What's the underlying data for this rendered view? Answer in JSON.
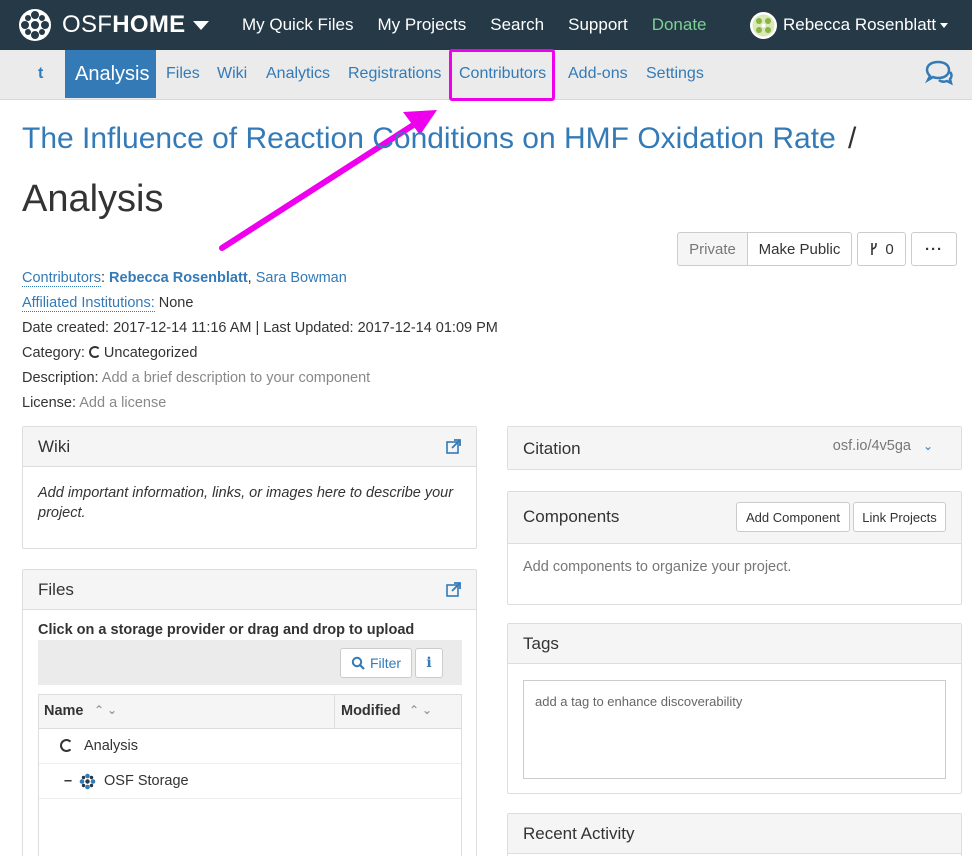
{
  "topnav": {
    "brand_light": "OSF",
    "brand_bold": "HOME",
    "links": [
      "My Quick Files",
      "My Projects",
      "Search",
      "Support",
      "Donate"
    ],
    "user_name": "Rebecca Rosenblatt",
    "colors": {
      "bg": "#263947",
      "donate": "#7bd195"
    }
  },
  "subnav": {
    "parent": "t",
    "active": "Analysis",
    "items": [
      "Files",
      "Wiki",
      "Analytics",
      "Registrations",
      "Contributors",
      "Add-ons",
      "Settings"
    ],
    "highlighted": "Contributors",
    "highlight_color": "#ee00ee"
  },
  "header": {
    "project_title": "The Influence of Reaction Conditions on HMF Oxidation Rate",
    "separator": "/",
    "component_title": "Analysis"
  },
  "actions": {
    "private": "Private",
    "make_public": "Make Public",
    "fork_count": "0",
    "more": "···"
  },
  "meta": {
    "contributors_label": "Contributors",
    "contributor_1": "Rebecca Rosenblatt",
    "contributor_2": "Sara Bowman",
    "institutions_label": "Affiliated Institutions:",
    "institutions_value": "None",
    "dates": "Date created: 2017-12-14 11:16 AM | Last Updated: 2017-12-14 01:09 PM",
    "category_label": "Category:",
    "category_value": "Uncategorized",
    "description_label": "Description:",
    "description_value": "Add a brief description to your component",
    "license_label": "License:",
    "license_value": "Add a license"
  },
  "wiki": {
    "title": "Wiki",
    "placeholder": "Add important information, links, or images here to describe your project."
  },
  "files": {
    "title": "Files",
    "instructions": "Click on a storage provider or drag and drop to upload",
    "filter_label": "Filter",
    "info_label": "i",
    "columns": [
      "Name",
      "Modified"
    ],
    "rows": [
      {
        "name": "Analysis",
        "icon": "component-icon"
      },
      {
        "name": "OSF Storage",
        "icon": "osf-storage-icon"
      }
    ]
  },
  "citation": {
    "title": "Citation",
    "url": "osf.io/4v5ga"
  },
  "components": {
    "title": "Components",
    "add_button": "Add Component",
    "link_button": "Link Projects",
    "empty_text": "Add components to organize your project."
  },
  "tags": {
    "title": "Tags",
    "placeholder": "add a tag to enhance discoverability"
  },
  "recent_activity": {
    "title": "Recent Activity"
  }
}
